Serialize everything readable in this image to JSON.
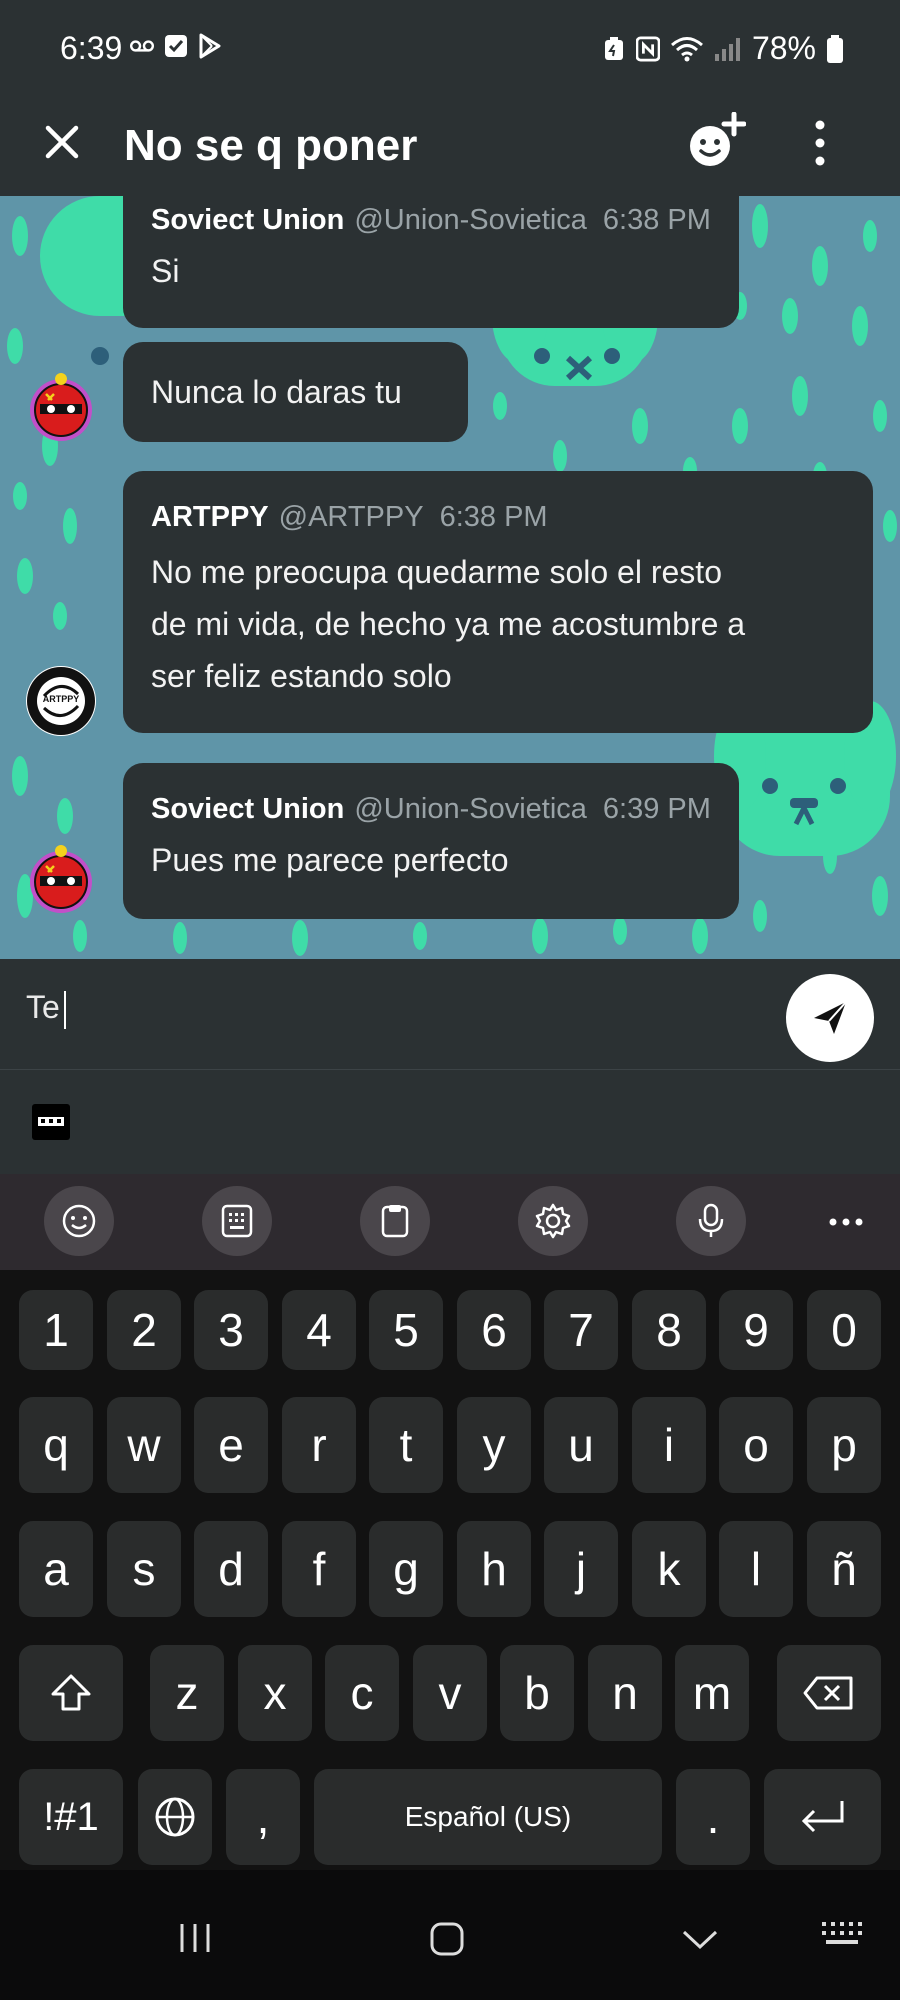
{
  "status_bar": {
    "time": "6:39",
    "battery": "78%"
  },
  "header": {
    "title": "No se q poner"
  },
  "messages": [
    {
      "author": "Soviect Union",
      "handle": "@Union-Sovietica",
      "time": "6:38 PM",
      "lines": [
        "Si"
      ]
    },
    {
      "author": "",
      "handle": "",
      "time": "",
      "lines": [
        "Nunca lo daras tu"
      ]
    },
    {
      "author": "ARTPPY",
      "handle": "@ARTPPY",
      "time": "6:38 PM",
      "lines": [
        "No me preocupa quedarme solo el resto",
        "de mi vida, de hecho ya me acostumbre a",
        "ser feliz estando solo"
      ]
    },
    {
      "author": "Soviect Union",
      "handle": "@Union-Sovietica",
      "time": "6:39 PM",
      "lines": [
        "Pues me parece perfecto"
      ]
    }
  ],
  "avatars": {
    "artppy_text": "ARTPPY"
  },
  "composer": {
    "text": "Te"
  },
  "keyboard": {
    "row_numbers": [
      "1",
      "2",
      "3",
      "4",
      "5",
      "6",
      "7",
      "8",
      "9",
      "0"
    ],
    "row_1": [
      "q",
      "w",
      "e",
      "r",
      "t",
      "y",
      "u",
      "i",
      "o",
      "p"
    ],
    "row_2": [
      "a",
      "s",
      "d",
      "f",
      "g",
      "h",
      "j",
      "k",
      "l",
      "ñ"
    ],
    "row_3": [
      "z",
      "x",
      "c",
      "v",
      "b",
      "n",
      "m"
    ],
    "symbols_key": "!#1",
    "comma_key": ",",
    "space_label": "Español (US)",
    "period_key": "."
  },
  "colors": {
    "bar_bg": "#2b3133",
    "chat_bg": "#5f95a8",
    "accent_green": "#3fdca8",
    "key_bg": "#2a2c2c"
  }
}
